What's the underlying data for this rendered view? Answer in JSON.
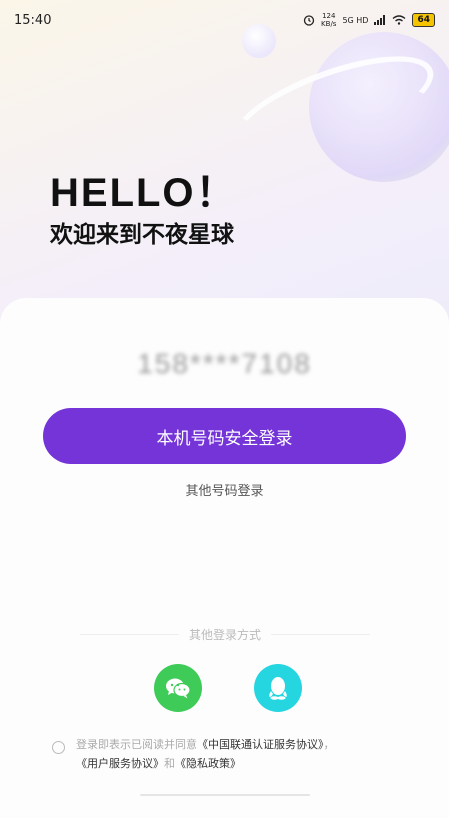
{
  "status_bar": {
    "time": "15:40",
    "net_speed_value": "124",
    "net_speed_unit": "KB/s",
    "signal_label": "5G HD",
    "battery": "64"
  },
  "hero": {
    "hello": "HELLO！",
    "welcome": "欢迎来到不夜星球"
  },
  "login": {
    "phone_masked": "158****7108",
    "primary_button": "本机号码安全登录",
    "other_number": "其他号码登录",
    "other_methods_label": "其他登录方式"
  },
  "agreement": {
    "prefix": "登录即表示已阅读并同意",
    "link_cu": "《中国联通认证服务协议》",
    "comma": "，",
    "link_user": "《用户服务协议》",
    "and": "和",
    "link_privacy": "《隐私政策》"
  },
  "colors": {
    "primary": "#7434d8",
    "wechat": "#3ecb58",
    "qq": "#25d6e0"
  }
}
